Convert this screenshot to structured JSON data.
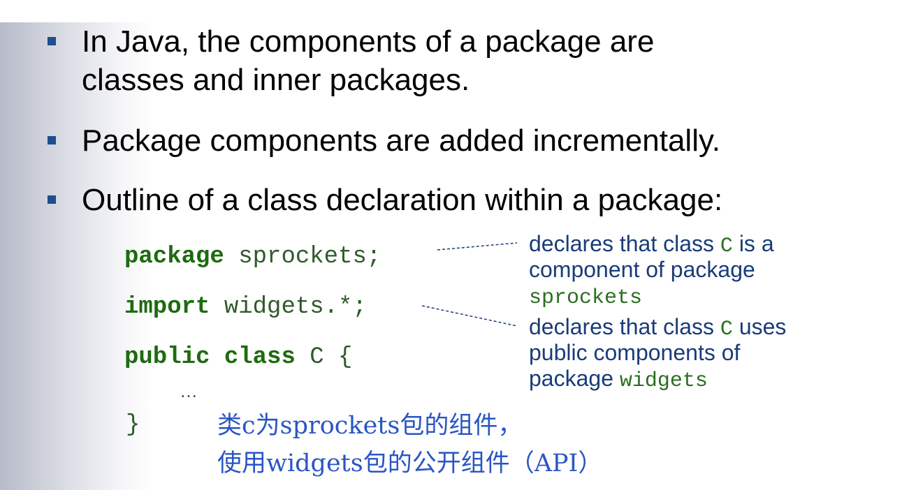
{
  "bullets": [
    {
      "line1": "In Java, the components of a package are",
      "line2": "classes and inner packages."
    },
    {
      "line1": "Package components are added incrementally."
    },
    {
      "line1": "Outline of a class declaration within a package:"
    }
  ],
  "code": {
    "line1_kw": "package",
    "line1_rest": " sprockets;",
    "line2_kw": "import",
    "line2_rest": " widgets.*;",
    "line3_kw1": "public",
    "line3_kw2": " class",
    "line3_rest": " C {",
    "ellipsis": "…",
    "closing": "}"
  },
  "notes": {
    "note1": {
      "pre": "declares that class ",
      "code": "C",
      "post": " is a",
      "line2": "component of package",
      "line3_code": "sprockets"
    },
    "note2": {
      "pre": "declares that class ",
      "code": "C",
      "post": " uses",
      "line2": "public components of",
      "line3_pre": "package ",
      "line3_code": "widgets"
    }
  },
  "chinese": {
    "line1": "类c为sprockets包的组件，",
    "line2": "使用widgets包的公开组件（API）"
  },
  "colors": {
    "bullet": "#1f4e8c",
    "keyword": "#1e6b10",
    "note_text": "#1a3c78",
    "chinese_text": "#2a55c4"
  }
}
